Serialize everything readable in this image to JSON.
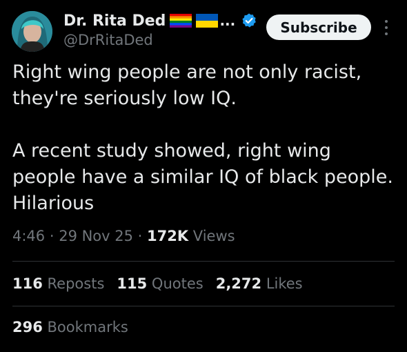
{
  "author": {
    "display_name": "Dr. Rita Ded",
    "name_overflow": "...",
    "handle": "@DrRitaDed"
  },
  "actions": {
    "subscribe_label": "Subscribe"
  },
  "tweet": {
    "text": "Right wing people are not only racist,\nthey're seriously low IQ.\n\nA recent study showed, right wing\npeople have a similar IQ of black people.\nHilarious"
  },
  "meta": {
    "time": "4:46",
    "sep1": " · ",
    "date": "29 Nov 25",
    "sep2": " · ",
    "views_count": "172K",
    "views_label": " Views"
  },
  "stats": {
    "reposts_count": "116",
    "reposts_label": " Reposts",
    "quotes_count": "115",
    "quotes_label": " Quotes",
    "likes_count": "2,272",
    "likes_label": " Likes",
    "bookmarks_count": "296",
    "bookmarks_label": " Bookmarks"
  },
  "colors": {
    "background": "#000000",
    "text_primary": "#e7e9ea",
    "text_secondary": "#71767b",
    "verified": "#1d9bf0",
    "divider": "#2f3336"
  },
  "icons": {
    "avatar": "profile-photo",
    "flag_1": "rainbow-flag-icon",
    "flag_2": "ukraine-flag-icon",
    "verified": "verified-badge-icon",
    "more": "more-options-icon"
  }
}
